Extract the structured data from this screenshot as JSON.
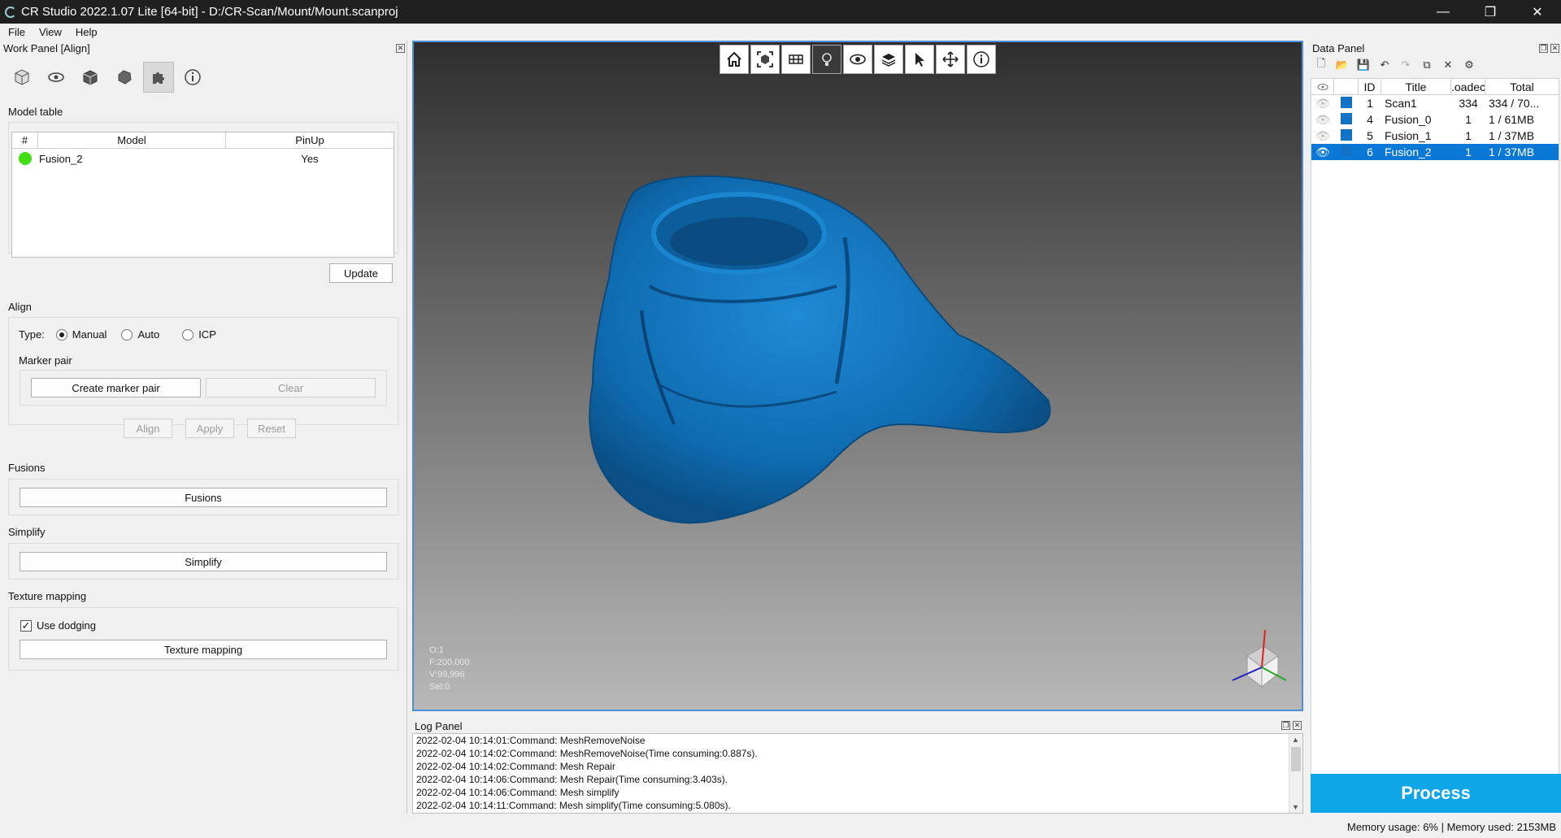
{
  "window": {
    "title": "CR Studio 2022.1.07 Lite [64-bit] - D:/CR-Scan/Mount/Mount.scanproj",
    "minimize_glyph": "—",
    "maximize_glyph": "❐",
    "close_glyph": "✕"
  },
  "menu": [
    "File",
    "View",
    "Help"
  ],
  "work_panel": {
    "title": "Work Panel [Align]",
    "toolbar_icons": [
      "cube-icon",
      "eye-icon",
      "multi-cube-icon",
      "mesh-icon",
      "puzzle-icon",
      "info-icon"
    ],
    "model_table": {
      "label": "Model table",
      "columns": [
        "#",
        "Model",
        "PinUp"
      ],
      "rows": [
        {
          "model": "Fusion_2",
          "pinup": "Yes",
          "status_color": "#44dd11"
        }
      ],
      "update_label": "Update"
    },
    "align": {
      "label": "Align",
      "type_label": "Type:",
      "options": [
        "Manual",
        "Auto",
        "ICP"
      ],
      "selected": "Manual",
      "marker_pair_label": "Marker pair",
      "create_marker_pair": "Create marker pair",
      "clear": "Clear",
      "align": "Align",
      "apply": "Apply",
      "reset": "Reset"
    },
    "fusions": {
      "label": "Fusions",
      "button": "Fusions"
    },
    "simplify": {
      "label": "Simplify",
      "button": "Simplify"
    },
    "texture_mapping": {
      "label": "Texture mapping",
      "use_dodging": "Use dodging",
      "use_dodging_checked": true,
      "button": "Texture mapping"
    }
  },
  "viewport": {
    "toolbar_icons": [
      "home-icon",
      "fit-view-icon",
      "view-mode-icon",
      "light-icon",
      "visibility-icon",
      "layers-icon",
      "select-icon",
      "move-icon",
      "info-icon"
    ],
    "stats": [
      "O:1",
      "F:200,000",
      "V:99,996",
      "Sel:0"
    ],
    "model_color": "#1173c8"
  },
  "log_panel": {
    "title": "Log Panel",
    "lines": [
      "2022-02-04 10:14:01:Command: MeshRemoveNoise",
      "2022-02-04 10:14:02:Command: MeshRemoveNoise(Time consuming:0.887s).",
      "2022-02-04 10:14:02:Command: Mesh Repair",
      "2022-02-04 10:14:06:Command: Mesh Repair(Time consuming:3.403s).",
      "2022-02-04 10:14:06:Command: Mesh simplify",
      "2022-02-04 10:14:11:Command: Mesh simplify(Time consuming:5.080s)."
    ]
  },
  "data_panel": {
    "title": "Data Panel",
    "toolbar_icons": [
      "new-file-icon",
      "open-folder-icon",
      "save-icon",
      "undo-icon",
      "redo-icon",
      "copy-icon",
      "delete-icon",
      "settings-icon"
    ],
    "columns": [
      "ID",
      "Title",
      ".oadec",
      "Total"
    ],
    "rows": [
      {
        "id": "1",
        "title": "Scan1",
        "loaded": "334",
        "total": "334 / 70...",
        "selected": false
      },
      {
        "id": "4",
        "title": "Fusion_0",
        "loaded": "1",
        "total": "1 / 61MB",
        "selected": false
      },
      {
        "id": "5",
        "title": "Fusion_1",
        "loaded": "1",
        "total": "1 / 37MB",
        "selected": false
      },
      {
        "id": "6",
        "title": "Fusion_2",
        "loaded": "1",
        "total": "1 / 37MB",
        "selected": true
      }
    ],
    "process_label": "Process"
  },
  "status_bar": {
    "text": "Memory usage: 6% | Memory used: 2153MB"
  },
  "colors": {
    "accent": "#0a78d7",
    "process": "#0ea6e6",
    "viewport_border": "#4a90d9"
  }
}
